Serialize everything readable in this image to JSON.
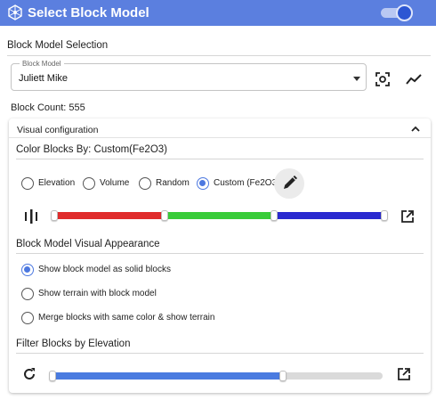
{
  "window": {
    "title": "Select Block Model",
    "toggle_on": true
  },
  "block_model_section": {
    "heading": "Block Model Selection",
    "field_label": "Block Model",
    "field_value": "Juliett Mike"
  },
  "block_count": "Block Count: 555",
  "visual_config": {
    "title": "Visual configuration",
    "color_heading": "Color Blocks By: Custom(Fe2O3)",
    "color_options": [
      {
        "label": "Elevation",
        "checked": false
      },
      {
        "label": "Volume",
        "checked": false
      },
      {
        "label": "Random",
        "checked": false
      },
      {
        "label": "Custom (Fe2O3)",
        "checked": true
      }
    ],
    "color_ramp": [
      {
        "color": "#e02c2c"
      },
      {
        "color": "#39cc39"
      },
      {
        "color": "#2a2ad0"
      }
    ],
    "appearance_heading": "Block Model Visual Appearance",
    "appearance_options": [
      {
        "label": "Show block model as solid blocks",
        "checked": true
      },
      {
        "label": "Show terrain with block model",
        "checked": false
      },
      {
        "label": "Merge blocks with same color & show terrain",
        "checked": false
      }
    ],
    "filter_heading": "Filter Blocks by Elevation",
    "filter_range": {
      "low": 0.0,
      "high": 0.7
    }
  },
  "colors": {
    "accent": "#5b7fdf",
    "radio_accent": "#4c78e0",
    "filter_track": "#4a7be0"
  },
  "icons": {
    "app_logo": "cube-network-icon",
    "focus": "focus-target-icon",
    "trend": "trend-line-icon",
    "collapse": "chevron-up-icon",
    "edit": "pencil-icon",
    "stepper": "bars-stepper-icon",
    "open_external": "open-in-new-icon",
    "reset": "refresh-icon"
  }
}
